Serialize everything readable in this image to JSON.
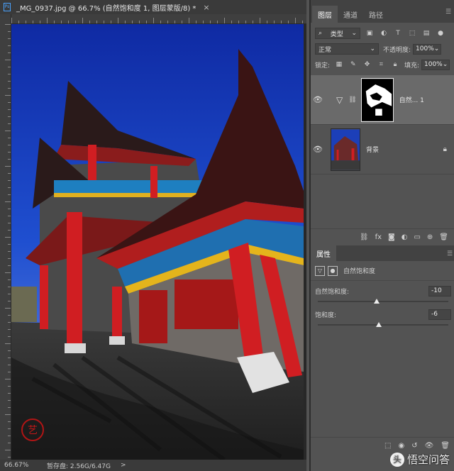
{
  "document": {
    "app_badge": "Ps",
    "tab_title": "_MG_0937.jpg @ 66.7% (自然饱和度 1, 图层蒙版/8) *",
    "close": "×"
  },
  "status_bar": {
    "zoom": "66.67%",
    "scratch": "暂存盘: 2.56G/6.47G",
    "arrow": ">"
  },
  "layers_panel": {
    "tabs": [
      "图层",
      "通道",
      "路径"
    ],
    "active_tab": 0,
    "filter_kind": "类型",
    "blend_mode": "正常",
    "opacity_label": "不透明度:",
    "opacity_value": "100%",
    "lock_label": "锁定:",
    "fill_label": "填充:",
    "fill_value": "100%",
    "layers": [
      {
        "name": "自然... 1",
        "selected": true,
        "type": "adjustment"
      },
      {
        "name": "背景",
        "selected": false,
        "type": "background",
        "locked": true
      }
    ]
  },
  "properties_panel": {
    "tab": "属性",
    "adjustment_name": "自然饱和度",
    "sliders": [
      {
        "label": "自然饱和度:",
        "value": "-10",
        "fraction": 0.45
      },
      {
        "label": "饱和度:",
        "value": "-6",
        "fraction": 0.47
      }
    ]
  },
  "watermark": {
    "logo": "头",
    "text": "悟空问答"
  },
  "colors": {
    "panel_bg": "#535353",
    "accent_blue": "#4aa3ff",
    "sky": "#1c3fb8",
    "pillar_red": "#d01e22"
  }
}
